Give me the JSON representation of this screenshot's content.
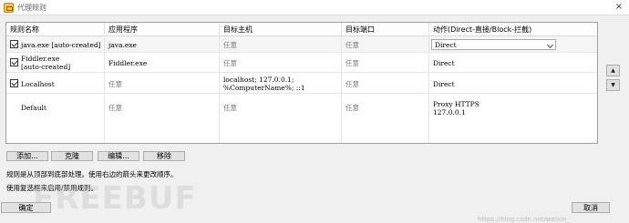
{
  "window": {
    "title": "代理规则",
    "close_glyph": "×"
  },
  "grid": {
    "headers": [
      "规则名称",
      "应用程序",
      "目标主机",
      "目标端口",
      "动作(Direct-直接/Block-拦截)"
    ],
    "rows": [
      {
        "checked": true,
        "name": "java.exe [auto-created]",
        "app": "java.exe",
        "host": "任意",
        "port": "任意",
        "action": "Direct",
        "action_is_dropdown": true
      },
      {
        "checked": true,
        "name": "Fiddler.exe\n[auto-created]",
        "app": "Fiddler.exe",
        "host": "任意",
        "port": "任意",
        "action": "Direct"
      },
      {
        "checked": true,
        "name": "Localhost",
        "app": "任意",
        "host": "localhost; 127.0.0.1;\n%ComputerName%; ::1",
        "port": "任意",
        "action": "Direct"
      },
      {
        "checked": false,
        "name": "Default",
        "app": "任意",
        "host": "任意",
        "port": "任意",
        "action": "Proxy HTTPS\n127.0.0.1"
      }
    ]
  },
  "side_buttons": {
    "up": "▲",
    "down": "▼"
  },
  "buttons": {
    "add": "添加...",
    "clone": "克隆",
    "edit": "编辑...",
    "remove": "移除"
  },
  "notes": [
    "规则是从顶部到底部处理。使用右边的箭头来更改顺序。",
    "使用复选框来启用/禁用规则。"
  ],
  "footer": {
    "ok": "确定",
    "cancel": "取消"
  },
  "watermark": {
    "logo": "FREEBUF",
    "url": "https://blog.csdn.net/weixin_"
  }
}
